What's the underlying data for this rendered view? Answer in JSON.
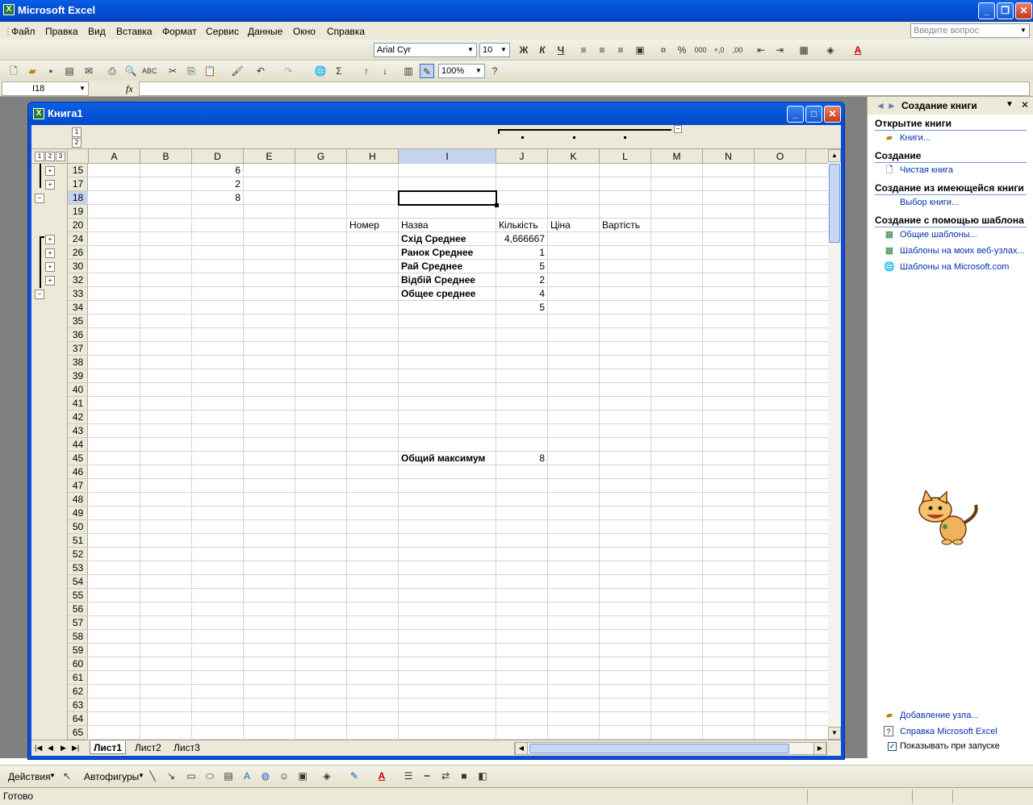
{
  "app": {
    "title": "Microsoft Excel",
    "ask": "Введите вопрос"
  },
  "menu": [
    "Файл",
    "Правка",
    "Вид",
    "Вставка",
    "Формат",
    "Сервис",
    "Данные",
    "Окно",
    "Справка"
  ],
  "fmt": {
    "font": "Arial Cyr",
    "size": "10",
    "bold": "Ж",
    "italic": "К",
    "underline": "Ч"
  },
  "std": {
    "zoom": "100%"
  },
  "formula": {
    "namebox": "I18",
    "fx": "fx"
  },
  "workbook": {
    "title": "Книга1"
  },
  "outline": {
    "levels": [
      "1",
      "2",
      "3"
    ],
    "cols": [
      "1",
      "2"
    ]
  },
  "columns": [
    "A",
    "B",
    "D",
    "E",
    "G",
    "H",
    "I",
    "J",
    "K",
    "L",
    "M",
    "N",
    "O"
  ],
  "rows": [
    "15",
    "17",
    "18",
    "19",
    "20",
    "24",
    "26",
    "30",
    "32",
    "33",
    "34",
    "35",
    "36",
    "37",
    "38",
    "39",
    "40",
    "41",
    "42",
    "43",
    "44",
    "45",
    "46",
    "47",
    "48",
    "49",
    "50",
    "51",
    "52",
    "53",
    "54",
    "55",
    "56",
    "57",
    "58",
    "59",
    "60",
    "61",
    "62",
    "63",
    "64",
    "65"
  ],
  "cells": {
    "d15": "6",
    "d17": "2",
    "d18": "8",
    "h20": "Номер",
    "i20": "Назва",
    "j20": "Кількість",
    "k20": "Ціна",
    "l20": "Вартість",
    "i24": "Схід Среднее",
    "j24": "4,666667",
    "i26": "Ранок Среднее",
    "j26": "1",
    "i30": "Рай Среднее",
    "j30": "5",
    "i32": "Відбій Среднее",
    "j32": "2",
    "i33": "Общее среднее",
    "j33": "4",
    "j34": "5",
    "i45": "Общий максимум",
    "j45": "8"
  },
  "sheets": [
    "Лист1",
    "Лист2",
    "Лист3"
  ],
  "taskpane": {
    "title": "Создание книги",
    "open": "Открытие книги",
    "open_link": "Книги...",
    "create": "Создание",
    "blank": "Чистая книга",
    "from_existing": "Создание из имеющейся книги",
    "choose": "Выбор книги...",
    "from_template": "Создание с помощью шаблона",
    "t1": "Общие шаблоны...",
    "t2": "Шаблоны на моих веб-узлах...",
    "t3": "Шаблоны на Microsoft.com",
    "add_node": "Добавление узла...",
    "help": "Справка Microsoft Excel",
    "show": "Показывать при запуске"
  },
  "drawbar": {
    "actions": "Действия",
    "autoshapes": "Автофигуры"
  },
  "status": "Готово"
}
